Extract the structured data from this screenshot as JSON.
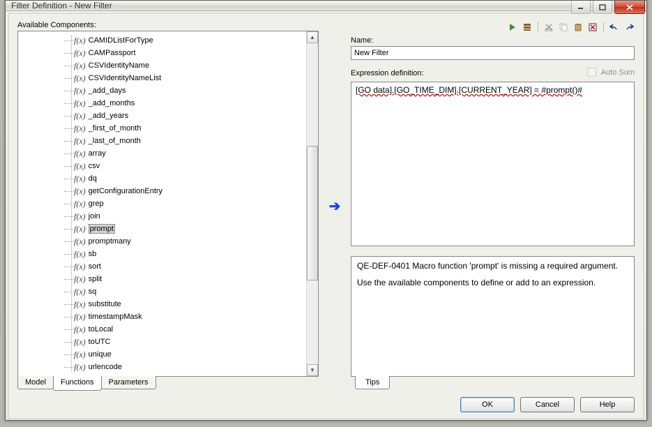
{
  "window": {
    "title": "Filter Definition - New Filter"
  },
  "left": {
    "heading": "Available Components:",
    "items": [
      "CAMIDListForType",
      "CAMPassport",
      "CSVIdentityName",
      "CSVIdentityNameList",
      "_add_days",
      "_add_months",
      "_add_years",
      "_first_of_month",
      "_last_of_month",
      "array",
      "csv",
      "dq",
      "getConfigurationEntry",
      "grep",
      "join",
      "prompt",
      "promptmany",
      "sb",
      "sort",
      "split",
      "sq",
      "substitute",
      "timestampMask",
      "toLocal",
      "toUTC",
      "unique",
      "urlencode"
    ],
    "selected_index": 15,
    "tabs": {
      "model": "Model",
      "functions": "Functions",
      "parameters": "Parameters",
      "active": "functions"
    }
  },
  "right": {
    "name_label": "Name:",
    "name_value": "New Filter",
    "expr_label": "Expression definition:",
    "autosum_label": "Auto Sum",
    "expr_value": "[GO data].[GO_TIME_DIM].[CURRENT_YEAR]  = #prompt()#",
    "tips_error": "QE-DEF-0401 Macro function 'prompt' is missing a required argument.",
    "tips_help": "Use the available components to define or add to an expression.",
    "tips_tab": "Tips"
  },
  "buttons": {
    "ok": "OK",
    "cancel": "Cancel",
    "help": "Help"
  }
}
